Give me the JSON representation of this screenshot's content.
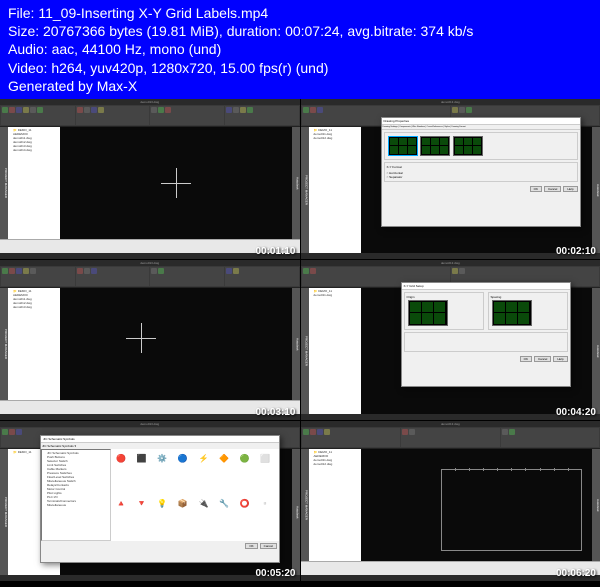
{
  "header": {
    "file_label": "File:",
    "filename": "11_09-Inserting X-Y Grid Labels.mp4",
    "size_label": "Size:",
    "size_bytes": "20767366 bytes (19.81 MiB),",
    "duration_label": "duration:",
    "duration": "00:07:24,",
    "bitrate_label": "avg.bitrate:",
    "bitrate": "374 kb/s",
    "audio_label": "Audio:",
    "audio": "aac, 44100 Hz, mono (und)",
    "video_label": "Video:",
    "video": "h264, yuv420p, 1280x720, 15.00 fps(r) (und)",
    "generated": "Generated by Max-X"
  },
  "app": {
    "title": "demo013.dwg",
    "pm_label": "PROJECT MANAGER",
    "right_label": "Autodesk",
    "tree_root": "DEMO_11",
    "tree_items": [
      "AEDEMO0",
      "demo011.dwg",
      "demo012.dwg",
      "demo013.dwg",
      "demo014.dwg",
      "demo015.dwg"
    ]
  },
  "timestamps": [
    "00:01:10",
    "00:02:10",
    "00:03:10",
    "00:04:20",
    "00:05:20",
    "00:06:20"
  ],
  "dialog_props": {
    "title": "Drawing Properties",
    "tabs": "Drawing Settings | Components | Wire Numbers | Cross-References | Styles | Drawing Format",
    "section1": "Drawing",
    "section2": "X-Y Format",
    "opt1": "Horizontal",
    "opt2": "Separator",
    "btn_ok": "OK",
    "btn_cancel": "Cancel",
    "btn_help": "Help",
    "btn_setup": "Setup"
  },
  "dialog_xy": {
    "title": "X-Y Grid Setup",
    "section1": "Origin",
    "section2": "Spacing",
    "btn_ok": "OK",
    "btn_cancel": "Cancel",
    "btn_help": "Help"
  },
  "dialog_symbols": {
    "title": "JIC Schematic Symbols",
    "menu_label": "JIC Schematic Symbols",
    "tree_items": [
      "JIC Schematic Symbols",
      "Push Buttons",
      "Selector Switch",
      "Limit Switches",
      "Cable Markers",
      "Pressure Switches",
      "Flow/Level Switches",
      "Miscellaneous Switch",
      "Relays/Contacts",
      "Motor Control",
      "Pilot Lights",
      "PLC I/O",
      "Terminals/Connectors",
      "Miscellaneous"
    ],
    "icons": [
      "🔴",
      "⬛",
      "⚙️",
      "🔵",
      "⚡",
      "🔶",
      "🟢",
      "⬜",
      "🔺",
      "🔻",
      "💡",
      "📦",
      "🔌",
      "🔧",
      "⭕",
      "▫️"
    ],
    "btn_ok": "OK",
    "btn_cancel": "Cancel"
  }
}
